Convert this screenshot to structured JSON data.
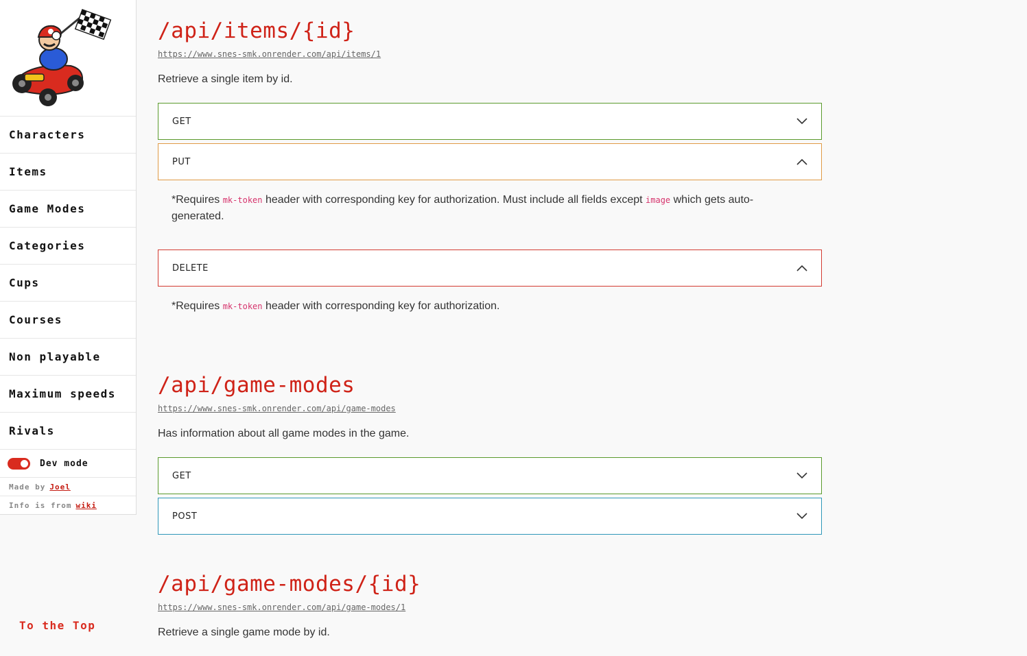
{
  "sidebar": {
    "logo_alt": "Mario in kart with checkered flag",
    "items": [
      {
        "label": "Characters"
      },
      {
        "label": "Items"
      },
      {
        "label": "Game Modes"
      },
      {
        "label": "Categories"
      },
      {
        "label": "Cups"
      },
      {
        "label": "Courses"
      },
      {
        "label": "Non playable"
      },
      {
        "label": "Maximum speeds"
      },
      {
        "label": "Rivals"
      }
    ],
    "dev_mode": {
      "label": "Dev mode",
      "enabled": true
    },
    "made_by_prefix": "Made by",
    "made_by_link": "Joel",
    "info_prefix": "Info is from",
    "info_link": "wiki",
    "to_top": "To the Top"
  },
  "colors": {
    "accent_red": "#cf2318",
    "get": "#5a9a2c",
    "put": "#e09a45",
    "delete": "#d33a30",
    "post": "#2e97b8",
    "code": "#d6336c"
  },
  "endpoints": [
    {
      "title": "/api/items/{id}",
      "url": "https://www.snes-smk.onrender.com/api/items/1",
      "description": "Retrieve a single item by id.",
      "methods": [
        {
          "name": "GET",
          "expanded": false
        },
        {
          "name": "PUT",
          "expanded": true,
          "note": {
            "pre": "*Requires ",
            "code1": "mk-token",
            "mid": " header with corresponding key for authorization. Must include all fields except ",
            "code2": "image",
            "post": " which gets auto-generated."
          }
        },
        {
          "name": "DELETE",
          "expanded": true,
          "note": {
            "pre": "*Requires ",
            "code1": "mk-token",
            "post": " header with corresponding key for authorization."
          }
        }
      ]
    },
    {
      "title": "/api/game-modes",
      "url": "https://www.snes-smk.onrender.com/api/game-modes",
      "description": "Has information about all game modes in the game.",
      "methods": [
        {
          "name": "GET",
          "expanded": false
        },
        {
          "name": "POST",
          "expanded": false
        }
      ]
    },
    {
      "title": "/api/game-modes/{id}",
      "url": "https://www.snes-smk.onrender.com/api/game-modes/1",
      "description": "Retrieve a single game mode by id.",
      "methods": []
    }
  ]
}
